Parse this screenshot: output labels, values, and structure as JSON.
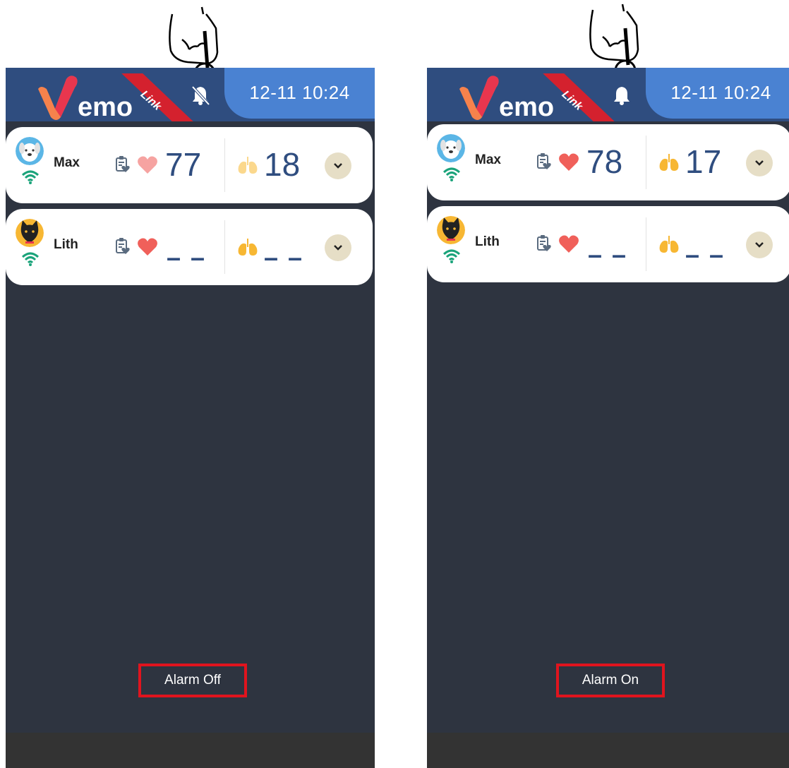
{
  "colors": {
    "app_bg": "#2e3440",
    "topbar": "#2f4d7f",
    "datebox": "#4a82d2",
    "metric_text": "#2f4d7f",
    "heart_active": "#f0605a",
    "lung_active": "#f7b733",
    "wifi": "#1aa37a",
    "highlight_box": "#e0141e"
  },
  "panels": [
    {
      "brand": {
        "logo_text": "emo",
        "ribbon_text": "Link"
      },
      "datetime": "12-11 10:24",
      "bell_icon": "bell-muted-icon",
      "patients": [
        {
          "name": "Max",
          "heart_rate": "77",
          "resp_rate": "18",
          "avatar_icon": "dog-avatar-icon"
        },
        {
          "name": "Lith",
          "heart_rate": "– –",
          "resp_rate": "– –",
          "avatar_icon": "cat-avatar-icon"
        }
      ],
      "alarm_status": "Alarm Off"
    },
    {
      "brand": {
        "logo_text": "emo",
        "ribbon_text": "Link"
      },
      "datetime": "12-11 10:24",
      "bell_icon": "bell-active-icon",
      "patients": [
        {
          "name": "Max",
          "heart_rate": "78",
          "resp_rate": "17",
          "avatar_icon": "dog-avatar-icon"
        },
        {
          "name": "Lith",
          "heart_rate": "– –",
          "resp_rate": "– –",
          "avatar_icon": "cat-avatar-icon"
        }
      ],
      "alarm_status": "Alarm On"
    }
  ]
}
